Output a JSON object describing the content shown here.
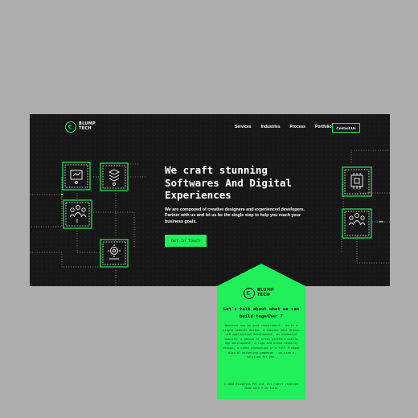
{
  "brand": {
    "line1": "BLUMP",
    "line2": "TECH",
    "accent": "#20f05a",
    "background": "#171717"
  },
  "nav": {
    "items": [
      "Services",
      "Industries",
      "Process",
      "Portfolio"
    ],
    "contact_label": "Contact Us"
  },
  "hero": {
    "title_lines": [
      "We craft stunning",
      "Softwares And Digital",
      "Experiences"
    ],
    "description": "We are composed of creative designers and experienced developers. Partner with us and let us be the single step to help you reach your business goals.",
    "cta_label": "Get in Touch"
  },
  "network_icons": [
    "dashboard-icon",
    "stack-icon",
    "people-icon",
    "gear-bulb-icon",
    "chip-icon",
    "people-icon"
  ],
  "card": {
    "heading": "Let's talk about what we can build together ?",
    "body": "Whatever may be your requirement - be it a simple website design, a complex data driven web application development, an ecommerce website, a native or cross platform mobile app development, a logo and brand identity design, a video production or a full fledged digital marketing campaign - we have a solution for you.",
    "copyright": "© 2018 BlumpTech Pvt Ltd. All rights reserved",
    "made_with_prefix": "Made with",
    "made_with_suffix": "in India"
  }
}
